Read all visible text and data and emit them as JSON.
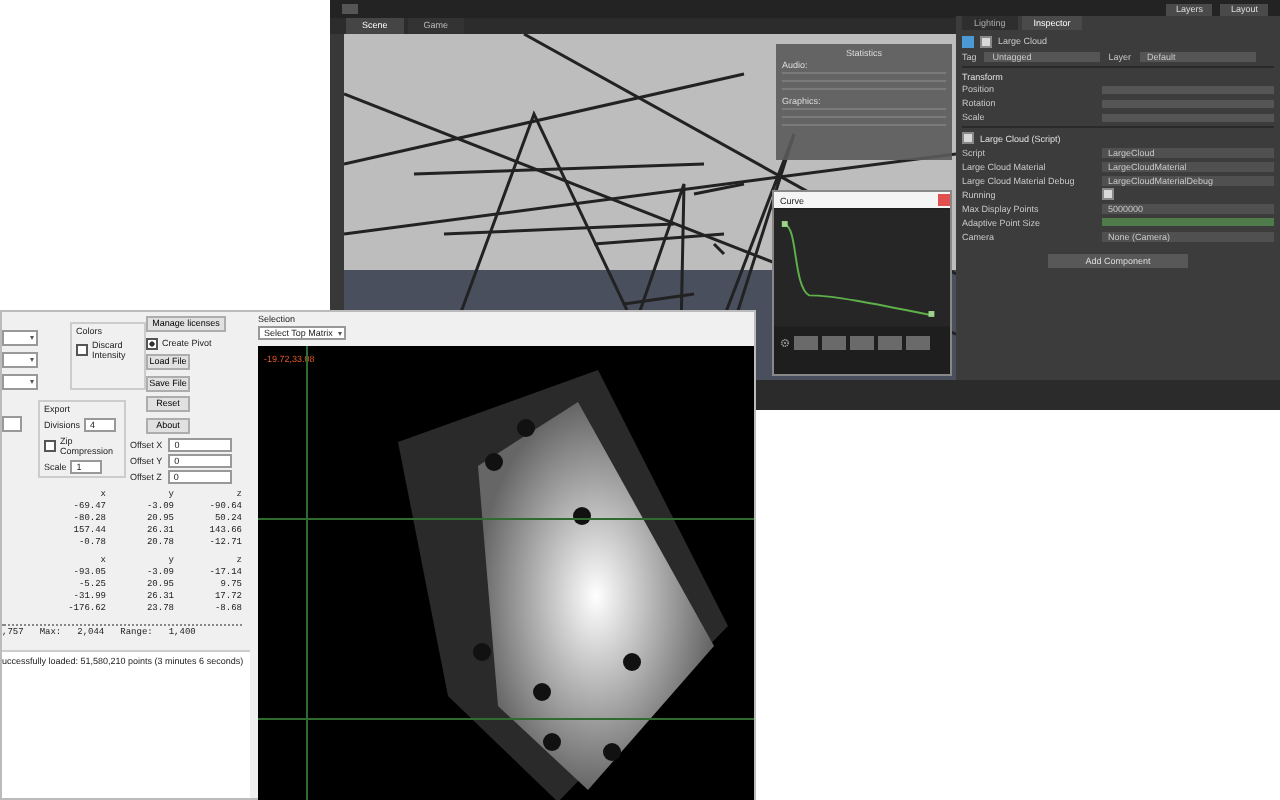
{
  "editor_window": {
    "toolbar": {
      "buttons": [
        "Layers",
        "Layout"
      ]
    },
    "view_tabs": [
      {
        "label": "Scene",
        "selected": true
      },
      {
        "label": "Game",
        "selected": false
      }
    ],
    "stats_panel": {
      "title": "Statistics",
      "sections": [
        "Audio:",
        "Graphics:"
      ]
    },
    "curve_dialog": {
      "title": "Curve"
    },
    "inspector": {
      "tabs": [
        {
          "label": "Lighting",
          "selected": false
        },
        {
          "label": "Inspector",
          "selected": true
        }
      ],
      "object": {
        "name": "Large Cloud",
        "active": true,
        "tag_label": "Tag",
        "tag": "Untagged",
        "layer_label": "Layer",
        "layer": "Default"
      },
      "transform": {
        "title": "Transform",
        "rows": [
          "Position",
          "Rotation",
          "Scale"
        ]
      },
      "script": {
        "title": "Large Cloud (Script)",
        "enabled": true,
        "rows": [
          {
            "kind": "field",
            "label": "Script",
            "value": "LargeCloud"
          },
          {
            "kind": "field",
            "label": "Large Cloud Material",
            "value": "LargeCloudMaterial"
          },
          {
            "kind": "field",
            "label": "Large Cloud Material Debug",
            "value": "LargeCloudMaterialDebug"
          },
          {
            "kind": "checkbox",
            "label": "Running",
            "checked": true
          },
          {
            "kind": "field",
            "label": "Max Display Points",
            "value": "5000000"
          },
          {
            "kind": "bar",
            "label": "Adaptive Point Size"
          },
          {
            "kind": "field",
            "label": "Camera",
            "value": "None (Camera)"
          }
        ]
      },
      "add_button": "Add Component"
    }
  },
  "converter_window": {
    "buttons": [
      "Manage licenses",
      "Load File",
      "Save File",
      "Reset",
      "About"
    ],
    "colors_group": {
      "title": "Colors",
      "discard_intensity": {
        "label": "Discard Intensity",
        "checked": false
      }
    },
    "create_pivot": {
      "label": "Create Pivot",
      "checked": true
    },
    "export_group": {
      "title": "Export",
      "divisions_label": "Divisions",
      "divisions": "4",
      "zip": {
        "label": "Zip Compression",
        "checked": false
      },
      "scale_label": "Scale",
      "scale": "1"
    },
    "offsets": [
      {
        "label": "Offset X",
        "value": "0"
      },
      {
        "label": "Offset Y",
        "value": "0"
      },
      {
        "label": "Offset Z",
        "value": "0"
      }
    ],
    "matrices": [
      {
        "headers": [
          "x",
          "y",
          "z"
        ],
        "rows": [
          [
            "-69.47",
            "-3.09",
            "-90.64"
          ],
          [
            "-80.28",
            "20.95",
            "50.24"
          ],
          [
            "157.44",
            "26.31",
            "143.66"
          ],
          [
            "-0.78",
            "20.78",
            "-12.71"
          ]
        ]
      },
      {
        "headers": [
          "x",
          "y",
          "z"
        ],
        "rows": [
          [
            "-93.05",
            "-3.09",
            "-17.14"
          ],
          [
            "-5.25",
            "20.95",
            "9.75"
          ],
          [
            "-31.99",
            "26.31",
            "17.72"
          ],
          [
            "-176.62",
            "23.78",
            "-8.68"
          ]
        ]
      }
    ],
    "stats": [
      ",757",
      "Max:",
      "2,044",
      "Range:",
      "1,400"
    ],
    "status_message": "uccessfully loaded: 51,580,210 points (3 minutes 6 seconds)",
    "selection_label": "Selection",
    "selection_dropdown": "Select Top Matrix",
    "viewer_coordinates": "-19.72,33.08"
  }
}
